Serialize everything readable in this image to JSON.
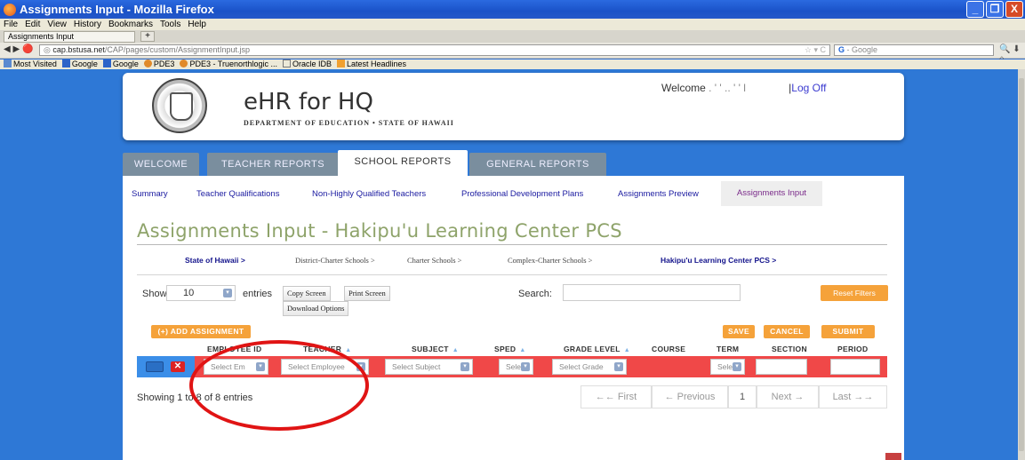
{
  "window": {
    "title": "Assignments Input - Mozilla Firefox",
    "min": "_",
    "max": "❐",
    "close": "X"
  },
  "menu": [
    "File",
    "Edit",
    "View",
    "History",
    "Bookmarks",
    "Tools",
    "Help"
  ],
  "browser_tab": {
    "label": "Assignments Input",
    "new_tab": "+"
  },
  "nav": {
    "arrows": "◀ ▶ 🔴",
    "url_host": "cap.bstusa.net",
    "url_path": "/CAP/pages/custom/AssignmentInput.jsp",
    "url_prefix": "◎ ",
    "star": "☆ ▾ C",
    "search_engine": "Google",
    "right_icons": "🔍 ⬇ ⌂"
  },
  "bookmarks": [
    "Most Visited",
    "Google",
    "Google",
    "PDE3",
    "PDE3 - Truenorthlogic ...",
    "Oracle IDB",
    "Latest Headlines"
  ],
  "header": {
    "brand_title": "eHR for HQ",
    "brand_sub": "DEPARTMENT OF EDUCATION • STATE OF HAWAII",
    "welcome": "Welcome",
    "user": ".  ' '      ..  '  ' l",
    "separator": "|",
    "logoff": "Log Off"
  },
  "main_tabs": [
    "WELCOME",
    "TEACHER REPORTS",
    "SCHOOL REPORTS",
    "GENERAL REPORTS"
  ],
  "active_tab": "SCHOOL REPORTS",
  "sub_nav": [
    "Summary",
    "Teacher Qualifications",
    "Non-Highly Qualified Teachers",
    "Professional Development Plans",
    "Assignments Preview",
    "Assignments Input"
  ],
  "page_title": "Assignments Input - Hakipu'u Learning Center PCS",
  "breadcrumb": [
    "State of Hawaii >",
    "District-Charter Schools >",
    "Charter Schools >",
    "Complex-Charter Schools >",
    "Hakipu'u Learning Center PCS >"
  ],
  "controls": {
    "show": "Show",
    "entries_value": "10",
    "entries": "entries",
    "copy_screen": "Copy Screen",
    "print_screen": "Print Screen",
    "download_options": "Download Options",
    "search_label": "Search:",
    "reset_filters": "Reset Filters"
  },
  "actions": {
    "add": "(+) ADD ASSIGNMENT",
    "save": "SAVE",
    "cancel": "CANCEL",
    "submit": "SUBMIT"
  },
  "columns": [
    "EMPLOYEE ID",
    "TEACHER",
    "SUBJECT",
    "SPED",
    "GRADE LEVEL",
    "COURSE",
    "TERM",
    "SECTION",
    "PERIOD"
  ],
  "row": {
    "employee_id": "Select Em",
    "teacher": "Select Employee",
    "subject": "Select Subject",
    "sped": "Selec",
    "grade": "Select Grade",
    "term": "Selec"
  },
  "info": "Showing 1 to 8 of 8 entries",
  "pager": {
    "first": "←← First",
    "previous": "← Previous",
    "page": "1",
    "next": "Next →",
    "last": "Last →→"
  },
  "colors": {
    "accent_orange": "#f5a23a",
    "row_red": "#f04848",
    "title_green": "#8ea36a",
    "bg_blue": "#2e78d6"
  }
}
